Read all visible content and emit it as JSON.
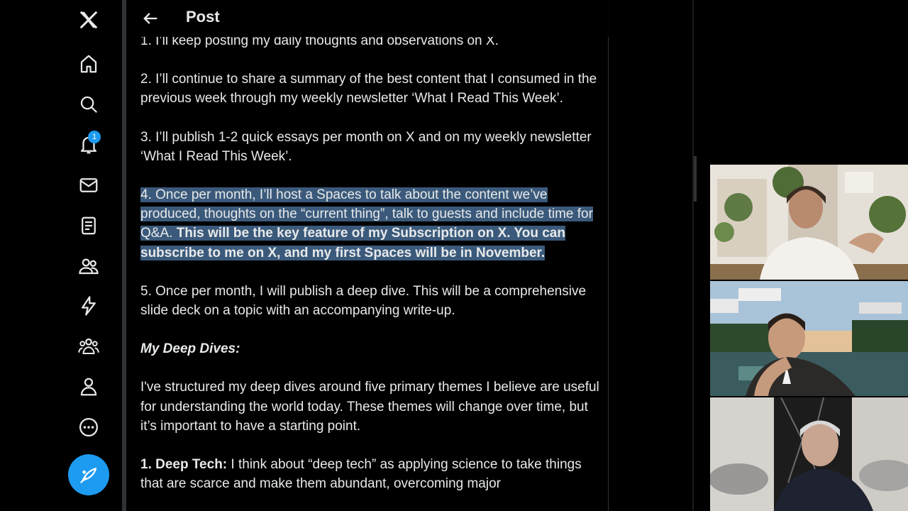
{
  "nav": {
    "logo": "x-logo-icon",
    "items": [
      "home-icon",
      "search-icon",
      "bell-icon",
      "mail-icon",
      "lists-icon",
      "communities-icon",
      "premium-icon",
      "verified-orgs-icon",
      "profile-icon",
      "more-icon"
    ],
    "notifications_badge": "1",
    "compose": "compose-icon"
  },
  "header": {
    "title": "Post"
  },
  "post": {
    "p1": "1. I’ll keep posting my daily thoughts and observations on X.",
    "p2": "2. I’ll continue to share a summary of the best content that I consumed in the previous week through my weekly newsletter ‘What I Read This Week’.",
    "p3": "3. I’ll publish 1-2 quick essays per month on X and on my weekly newsletter ‘What I Read This Week’.",
    "p4_normal": "4. Once per month, I’ll host a Spaces to talk about the content we’ve produced, thoughts on the “current thing”, talk to guests and include time for Q&A.",
    "p4_bold": "This will be the key feature of my Subscription on X. You can subscribe to me on X, and my first Spaces will be in November.",
    "p5": "5. Once per month, I will publish a deep dive. This will be a comprehensive slide deck on a topic with an accompanying write-up.",
    "heading": "My Deep Dives:",
    "p6": "I've structured my deep dives around five primary themes I believe are useful for understanding the world today. These themes will change over time, but it’s important to have a starting point.",
    "p7_bold": "1. Deep Tech:",
    "p7": "I think about “deep tech” as applying science to take things that are scarce and make them abundant, overcoming major"
  },
  "colors": {
    "accent": "#1d9bf0",
    "highlight": "#3b5a7b",
    "background": "#000000"
  }
}
